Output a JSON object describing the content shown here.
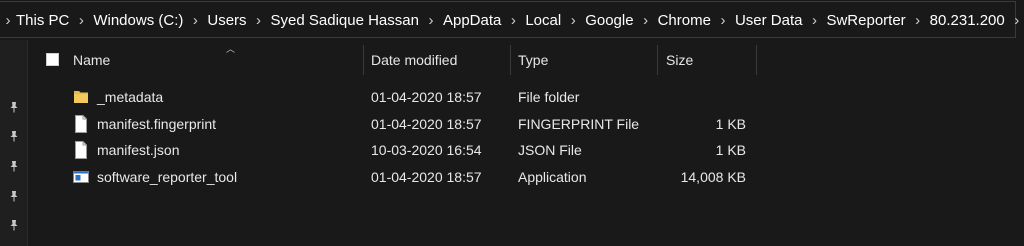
{
  "address_bar": {
    "crumbs": [
      "This PC",
      "Windows (C:)",
      "Users",
      "Syed Sadique Hassan",
      "AppData",
      "Local",
      "Google",
      "Chrome",
      "User Data",
      "SwReporter",
      "80.231.200"
    ]
  },
  "columns": {
    "name": "Name",
    "date_modified": "Date modified",
    "type": "Type",
    "size": "Size"
  },
  "files": [
    {
      "name": "_metadata",
      "date": "01-04-2020 18:57",
      "type": "File folder",
      "size": "",
      "icon": "folder-icon"
    },
    {
      "name": "manifest.fingerprint",
      "date": "01-04-2020 18:57",
      "type": "FINGERPRINT File",
      "size": "1 KB",
      "icon": "file-icon"
    },
    {
      "name": "manifest.json",
      "date": "10-03-2020 16:54",
      "type": "JSON File",
      "size": "1 KB",
      "icon": "file-icon"
    },
    {
      "name": "software_reporter_tool",
      "date": "01-04-2020 18:57",
      "type": "Application",
      "size": "14,008 KB",
      "icon": "application-icon"
    }
  ],
  "colors": {
    "background": "#191919",
    "text": "#e8e8e8",
    "folder": "#e8b84a"
  }
}
